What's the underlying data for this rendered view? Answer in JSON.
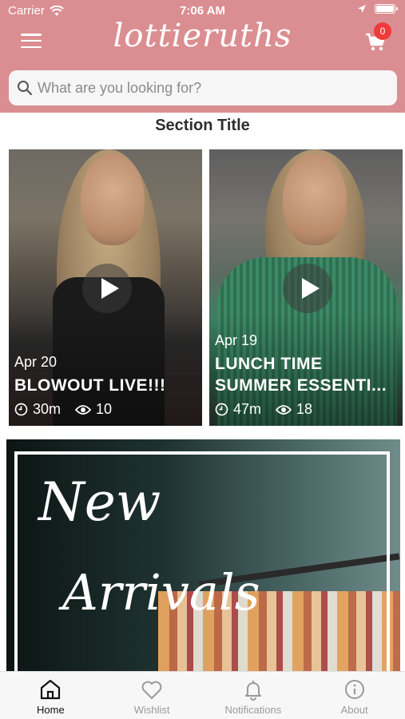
{
  "status_bar": {
    "carrier": "Carrier",
    "time": "7:06 AM"
  },
  "header": {
    "logo_text": "lottieruths",
    "cart_count": "0",
    "background_color": "#db8e91"
  },
  "search": {
    "placeholder": "What are you looking for?"
  },
  "section_title": "Section Title",
  "videos": [
    {
      "date": "Apr 20",
      "title_line1": "BLOWOUT LIVE!!!",
      "title_line2": "",
      "duration": "30m",
      "views": "10"
    },
    {
      "date": "Apr 19",
      "title_line1": "LUNCH TIME",
      "title_line2": "SUMMER ESSENTI...",
      "duration": "47m",
      "views": "18"
    }
  ],
  "banner": {
    "line1": "New",
    "line2": "Arrivals"
  },
  "tabs": [
    {
      "label": "Home",
      "icon": "home-icon",
      "active": true
    },
    {
      "label": "Wishlist",
      "icon": "heart-icon",
      "active": false
    },
    {
      "label": "Notifications",
      "icon": "bell-icon",
      "active": false
    },
    {
      "label": "About",
      "icon": "info-icon",
      "active": false
    }
  ],
  "colors": {
    "badge": "#ef3b3b",
    "active_tab": "#111111",
    "inactive_tab": "#9a9a9a"
  }
}
